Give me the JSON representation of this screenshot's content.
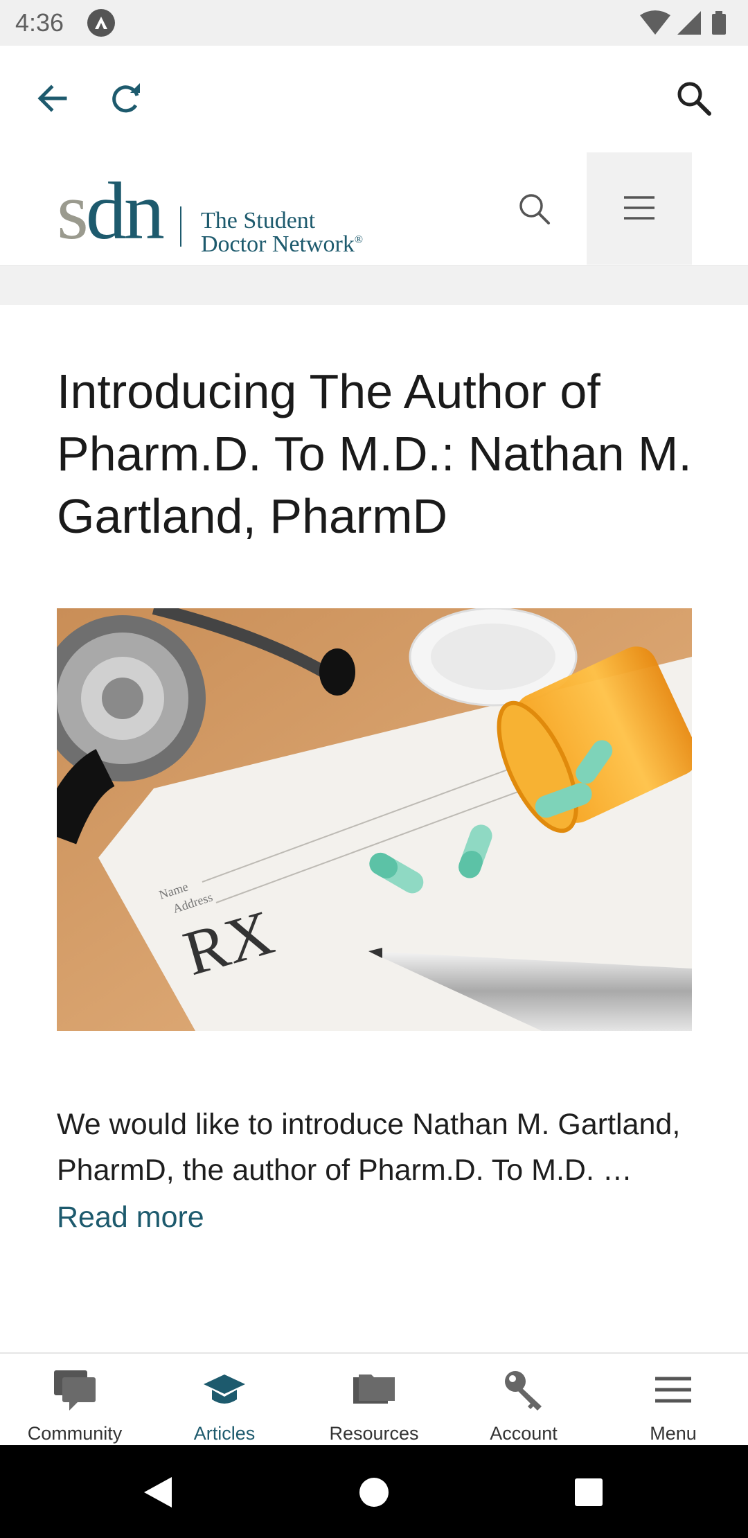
{
  "status_bar": {
    "time": "4:36",
    "icons": [
      "app-notification-icon",
      "wifi-icon",
      "cellular-signal-icon",
      "battery-icon"
    ]
  },
  "browser_toolbar": {
    "icons": [
      "back-arrow-icon",
      "refresh-icon",
      "search-icon"
    ]
  },
  "site_header": {
    "logo_mark": "sdn",
    "logo_line1": "The Student",
    "logo_line2": "Doctor Network",
    "logo_registered": "®",
    "icons": [
      "search-icon",
      "hamburger-menu-icon"
    ]
  },
  "article": {
    "title": "Introducing The Author of Pharm.D. To M.D.: Nathan M. Gartland, PharmD",
    "image_description_icon": "prescription-pills-stethoscope-photo",
    "excerpt": "We would like to introduce Nathan M. Gartland, PharmD, the author of Pharm.D. To M.D. …",
    "read_more": "Read more"
  },
  "bottom_nav": {
    "active": "Articles",
    "items": [
      {
        "label": "Community",
        "icon": "chat-bubbles-icon"
      },
      {
        "label": "Articles",
        "icon": "graduation-cap-icon"
      },
      {
        "label": "Resources",
        "icon": "folders-icon"
      },
      {
        "label": "Account",
        "icon": "key-icon"
      },
      {
        "label": "Menu",
        "icon": "hamburger-menu-icon"
      }
    ]
  },
  "system_nav": {
    "icons": [
      "back-triangle-icon",
      "home-circle-icon",
      "recents-square-icon"
    ]
  },
  "colors": {
    "brand_teal": "#1d5a6d",
    "logo_gray": "#9a9a8e",
    "status_bar_bg": "#f0f0f0",
    "band_gray": "#f1f1f1"
  }
}
